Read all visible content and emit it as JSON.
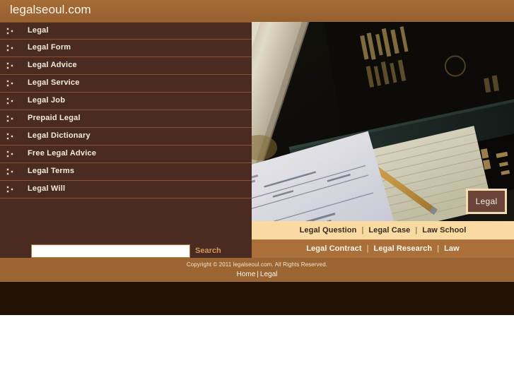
{
  "header": {
    "site_title": "legalseoul.com",
    "background_color": "#9c6633"
  },
  "sidebar": {
    "background_color": "#4a2b21",
    "separator_color": "#8a5328",
    "bullet_icon": "three-squares-bullet-icon",
    "items": [
      {
        "label": "Legal"
      },
      {
        "label": "Legal Form"
      },
      {
        "label": "Legal Advice"
      },
      {
        "label": "Legal Service"
      },
      {
        "label": "Legal Job"
      },
      {
        "label": "Prepaid Legal"
      },
      {
        "label": "Legal Dictionary"
      },
      {
        "label": "Free Legal Advice"
      },
      {
        "label": "Legal Terms"
      },
      {
        "label": "Legal Will"
      }
    ],
    "search": {
      "value": "",
      "placeholder": "",
      "button_label": "Search",
      "button_color": "#cf9a57"
    }
  },
  "hero": {
    "image_description": "law-books-document-pencil-photo",
    "badge_label": "Legal",
    "badge_border_color": "#f2ddb0",
    "badge_background_color": "#6a4436"
  },
  "link_bars": [
    {
      "name": "primary-link-bar",
      "background_color": "#f8daa2",
      "text_color": "#3a2a1c",
      "links": [
        "Legal Question",
        "Legal Case",
        "Law School"
      ],
      "separator": "|"
    },
    {
      "name": "secondary-link-bar",
      "background_color": "#ab6f39",
      "text_color": "#fdf6ec",
      "links": [
        "Legal Contract",
        "Legal Research",
        "Law"
      ],
      "separator": "|"
    }
  ],
  "footer": {
    "background_color": "#9c6633",
    "copyright": "Copyright © 2011 legalseoul.com. All Rights Reserved.",
    "links": [
      "Home",
      "Legal"
    ],
    "separator": "|",
    "bottom_band_color": "#211203"
  }
}
